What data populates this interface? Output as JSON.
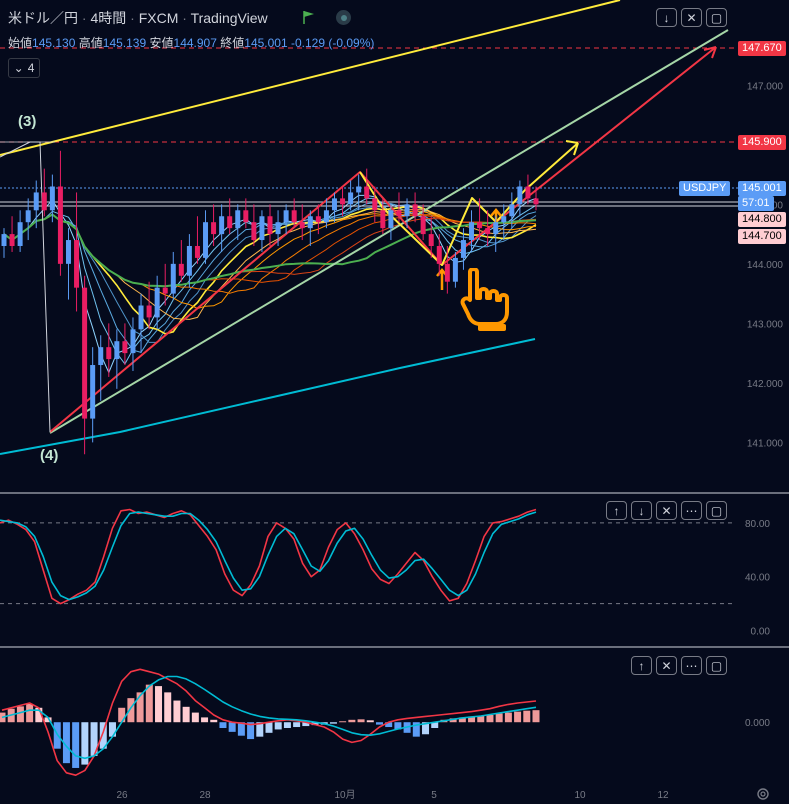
{
  "header": {
    "symbol": "米ドル／円",
    "interval": "4時間",
    "broker": "FXCM",
    "platform": "TradingView",
    "sep": "·"
  },
  "ohlc": {
    "open_label": "始値",
    "open": "145.130",
    "high_label": "高値",
    "high": "145.139",
    "low_label": "安値",
    "low": "144.907",
    "close_label": "終値",
    "close": "145.001",
    "change": "-0.129 (-0.09%)"
  },
  "indicator_toggle": {
    "count": "4"
  },
  "price_labels": {
    "target_high": "147.670",
    "target_mid": "145.900",
    "ticker": "USDJPY",
    "last": "145.001",
    "countdown": "57:01",
    "level_a": "144.800",
    "level_b": "144.700"
  },
  "wave_labels": {
    "top": "(3)",
    "bottom": "(4)"
  },
  "colors": {
    "bg": "#050a1c",
    "up": "#5b9cf6",
    "down": "#e91e63",
    "yellow": "#ffeb3b",
    "red": "#f23645",
    "teal": "#00bcd4",
    "green": "#4caf50",
    "light_green": "#a5d6a7",
    "orange": "#ff9800"
  },
  "icons": [
    "chevron-down-icon",
    "collapse-icon",
    "maximize-icon",
    "arrow-up-icon",
    "arrow-down-icon",
    "close-icon",
    "gear-icon",
    "pointing-hand-icon",
    "up-arrow-marker"
  ],
  "chart_data": [
    {
      "type": "candlestick",
      "title": "米ドル／円 · 4時間 · FXCM",
      "y_axis": {
        "ticks": [
          141.0,
          142.0,
          143.0,
          144.0,
          145.0,
          146.0,
          147.0
        ],
        "tick_labels": [
          "141.000",
          "142.000",
          "143.000",
          "144.000",
          "145.000",
          "146.000",
          "147.000"
        ],
        "range": [
          140.2,
          148.4
        ]
      },
      "x_axis": {
        "tick_labels": [
          "26",
          "28",
          "10月",
          "5",
          "10",
          "12"
        ]
      },
      "candles": [
        {
          "o": 144.3,
          "h": 144.6,
          "l": 144.1,
          "c": 144.5
        },
        {
          "o": 144.5,
          "h": 144.8,
          "l": 144.2,
          "c": 144.3
        },
        {
          "o": 144.3,
          "h": 144.9,
          "l": 144.2,
          "c": 144.7
        },
        {
          "o": 144.7,
          "h": 145.1,
          "l": 144.4,
          "c": 144.9
        },
        {
          "o": 144.9,
          "h": 145.4,
          "l": 144.6,
          "c": 145.2
        },
        {
          "o": 145.2,
          "h": 145.6,
          "l": 144.8,
          "c": 144.9
        },
        {
          "o": 144.9,
          "h": 145.5,
          "l": 144.7,
          "c": 145.3
        },
        {
          "o": 145.3,
          "h": 145.9,
          "l": 143.8,
          "c": 144.0
        },
        {
          "o": 144.0,
          "h": 144.6,
          "l": 143.4,
          "c": 144.4
        },
        {
          "o": 144.4,
          "h": 145.2,
          "l": 143.2,
          "c": 143.6
        },
        {
          "o": 143.6,
          "h": 143.8,
          "l": 140.8,
          "c": 141.4
        },
        {
          "o": 141.4,
          "h": 142.6,
          "l": 141.0,
          "c": 142.3
        },
        {
          "o": 142.3,
          "h": 142.8,
          "l": 141.7,
          "c": 142.6
        },
        {
          "o": 142.6,
          "h": 143.0,
          "l": 142.1,
          "c": 142.4
        },
        {
          "o": 142.4,
          "h": 142.9,
          "l": 141.9,
          "c": 142.7
        },
        {
          "o": 142.7,
          "h": 143.0,
          "l": 142.3,
          "c": 142.5
        },
        {
          "o": 142.5,
          "h": 143.1,
          "l": 142.2,
          "c": 142.9
        },
        {
          "o": 142.9,
          "h": 143.5,
          "l": 142.5,
          "c": 143.3
        },
        {
          "o": 143.3,
          "h": 143.7,
          "l": 142.9,
          "c": 143.1
        },
        {
          "o": 143.1,
          "h": 143.8,
          "l": 142.9,
          "c": 143.6
        },
        {
          "o": 143.6,
          "h": 144.0,
          "l": 143.3,
          "c": 143.5
        },
        {
          "o": 143.5,
          "h": 144.2,
          "l": 143.4,
          "c": 144.0
        },
        {
          "o": 144.0,
          "h": 144.4,
          "l": 143.7,
          "c": 143.8
        },
        {
          "o": 143.8,
          "h": 144.5,
          "l": 143.6,
          "c": 144.3
        },
        {
          "o": 144.3,
          "h": 144.8,
          "l": 144.0,
          "c": 144.1
        },
        {
          "o": 144.1,
          "h": 144.9,
          "l": 144.0,
          "c": 144.7
        },
        {
          "o": 144.7,
          "h": 145.0,
          "l": 144.3,
          "c": 144.5
        },
        {
          "o": 144.5,
          "h": 145.0,
          "l": 144.2,
          "c": 144.8
        },
        {
          "o": 144.8,
          "h": 145.1,
          "l": 144.5,
          "c": 144.6
        },
        {
          "o": 144.6,
          "h": 145.0,
          "l": 144.4,
          "c": 144.9
        },
        {
          "o": 144.9,
          "h": 145.1,
          "l": 144.6,
          "c": 144.7
        },
        {
          "o": 144.7,
          "h": 145.0,
          "l": 144.3,
          "c": 144.4
        },
        {
          "o": 144.4,
          "h": 144.9,
          "l": 144.2,
          "c": 144.8
        },
        {
          "o": 144.8,
          "h": 145.0,
          "l": 144.3,
          "c": 144.5
        },
        {
          "o": 144.5,
          "h": 144.9,
          "l": 144.3,
          "c": 144.7
        },
        {
          "o": 144.7,
          "h": 145.0,
          "l": 144.5,
          "c": 144.9
        },
        {
          "o": 144.9,
          "h": 145.1,
          "l": 144.6,
          "c": 144.7
        },
        {
          "o": 144.7,
          "h": 145.0,
          "l": 144.4,
          "c": 144.6
        },
        {
          "o": 144.6,
          "h": 144.9,
          "l": 144.3,
          "c": 144.8
        },
        {
          "o": 144.8,
          "h": 145.0,
          "l": 144.5,
          "c": 144.7
        },
        {
          "o": 144.7,
          "h": 145.1,
          "l": 144.6,
          "c": 144.9
        },
        {
          "o": 144.9,
          "h": 145.2,
          "l": 144.7,
          "c": 145.1
        },
        {
          "o": 145.1,
          "h": 145.3,
          "l": 144.8,
          "c": 145.0
        },
        {
          "o": 145.0,
          "h": 145.4,
          "l": 144.9,
          "c": 145.2
        },
        {
          "o": 145.2,
          "h": 145.5,
          "l": 144.9,
          "c": 145.3
        },
        {
          "o": 145.3,
          "h": 145.6,
          "l": 145.0,
          "c": 145.1
        },
        {
          "o": 145.1,
          "h": 145.3,
          "l": 144.7,
          "c": 144.9
        },
        {
          "o": 144.9,
          "h": 145.1,
          "l": 144.5,
          "c": 144.6
        },
        {
          "o": 144.6,
          "h": 145.0,
          "l": 144.4,
          "c": 144.9
        },
        {
          "o": 144.9,
          "h": 145.2,
          "l": 144.7,
          "c": 144.8
        },
        {
          "o": 144.8,
          "h": 145.1,
          "l": 144.6,
          "c": 145.0
        },
        {
          "o": 145.0,
          "h": 145.2,
          "l": 144.7,
          "c": 144.8
        },
        {
          "o": 144.8,
          "h": 145.0,
          "l": 144.4,
          "c": 144.5
        },
        {
          "o": 144.5,
          "h": 144.8,
          "l": 144.1,
          "c": 144.3
        },
        {
          "o": 144.3,
          "h": 144.5,
          "l": 143.8,
          "c": 144.0
        },
        {
          "o": 144.0,
          "h": 144.3,
          "l": 143.5,
          "c": 143.7
        },
        {
          "o": 143.7,
          "h": 144.2,
          "l": 143.6,
          "c": 144.1
        },
        {
          "o": 144.1,
          "h": 144.6,
          "l": 143.9,
          "c": 144.4
        },
        {
          "o": 144.4,
          "h": 144.9,
          "l": 144.2,
          "c": 144.7
        },
        {
          "o": 144.7,
          "h": 145.1,
          "l": 144.4,
          "c": 144.6
        },
        {
          "o": 144.6,
          "h": 144.9,
          "l": 144.3,
          "c": 144.5
        },
        {
          "o": 144.5,
          "h": 144.8,
          "l": 144.2,
          "c": 144.7
        },
        {
          "o": 144.7,
          "h": 145.0,
          "l": 144.4,
          "c": 144.8
        },
        {
          "o": 144.8,
          "h": 145.2,
          "l": 144.6,
          "c": 145.0
        },
        {
          "o": 145.0,
          "h": 145.4,
          "l": 144.8,
          "c": 145.3
        },
        {
          "o": 145.3,
          "h": 145.5,
          "l": 145.0,
          "c": 145.1
        },
        {
          "o": 145.1,
          "h": 145.3,
          "l": 144.9,
          "c": 145.0
        }
      ],
      "levels": [
        147.67,
        145.9,
        145.001,
        144.8,
        144.7
      ]
    },
    {
      "type": "line",
      "title": "Stochastic RSI",
      "y_axis": {
        "tick_labels": [
          "80.00",
          "40.00",
          "0.00"
        ],
        "ticks": [
          80,
          40,
          0
        ],
        "range": [
          -10,
          100
        ]
      },
      "guides": [
        80,
        20
      ],
      "series": [
        {
          "values": [
            80,
            82,
            79,
            75,
            66,
            45,
            24,
            20,
            23,
            27,
            30,
            36,
            55,
            76,
            89,
            90,
            87,
            88,
            86,
            84,
            87,
            89,
            86,
            78,
            70,
            60,
            42,
            30,
            26,
            34,
            48,
            70,
            80,
            76,
            68,
            50,
            40,
            45,
            62,
            75,
            80,
            72,
            60,
            46,
            38,
            35,
            42,
            50,
            58,
            52,
            40,
            30,
            22,
            24,
            35,
            52,
            70,
            80,
            81,
            83,
            85,
            88,
            90
          ]
        },
        {
          "values": [
            82,
            81,
            80,
            77,
            70,
            55,
            36,
            26,
            23,
            25,
            28,
            33,
            45,
            62,
            78,
            87,
            88,
            87,
            86,
            85,
            85,
            87,
            87,
            82,
            75,
            66,
            52,
            39,
            30,
            31,
            40,
            56,
            70,
            76,
            72,
            60,
            48,
            44,
            52,
            65,
            74,
            76,
            68,
            56,
            45,
            39,
            40,
            45,
            52,
            53,
            46,
            38,
            30,
            26,
            30,
            42,
            58,
            72,
            79,
            81,
            83,
            86,
            88
          ]
        }
      ]
    },
    {
      "type": "bar",
      "title": "MACD",
      "y_axis": {
        "tick_labels": [
          "0.000"
        ],
        "ticks": [
          0
        ],
        "range": [
          -1.2,
          1.5
        ]
      },
      "histogram": [
        0.2,
        0.28,
        0.33,
        0.38,
        0.3,
        0.1,
        -0.55,
        -0.85,
        -0.95,
        -0.88,
        -0.7,
        -0.55,
        -0.3,
        0.3,
        0.5,
        0.62,
        0.78,
        0.75,
        0.62,
        0.45,
        0.32,
        0.2,
        0.1,
        0.05,
        -0.12,
        -0.2,
        -0.28,
        -0.35,
        -0.3,
        -0.22,
        -0.15,
        -0.12,
        -0.1,
        -0.08,
        -0.06,
        -0.05,
        -0.03,
        0.02,
        0.05,
        0.06,
        0.04,
        -0.05,
        -0.1,
        -0.15,
        -0.22,
        -0.3,
        -0.25,
        -0.12,
        0.05,
        0.08,
        0.1,
        0.12,
        0.13,
        0.15,
        0.18,
        0.2,
        0.22,
        0.24,
        0.25
      ],
      "series": [
        {
          "values": [
            0.25,
            0.3,
            0.35,
            0.4,
            0.3,
            -0.2,
            -0.8,
            -1.05,
            -1.1,
            -1.0,
            -0.7,
            -0.2,
            0.4,
            0.85,
            1.05,
            1.1,
            1.05,
            1.0,
            0.9,
            0.8,
            0.65,
            0.45,
            0.3,
            0.15,
            0.05,
            0.0,
            -0.02,
            -0.05,
            -0.03,
            0.0,
            0.03,
            0.05,
            0.03,
            0.0,
            -0.05,
            -0.1,
            -0.2,
            -0.35,
            -0.42,
            -0.38,
            -0.25,
            -0.1,
            0.0,
            0.05,
            0.08,
            0.1,
            0.12,
            0.14,
            0.16,
            0.18,
            0.2,
            0.22,
            0.25,
            0.28,
            0.33,
            0.37,
            0.4,
            0.42,
            0.44
          ]
        },
        {
          "values": [
            0.1,
            0.15,
            0.2,
            0.25,
            0.25,
            0.1,
            -0.25,
            -0.5,
            -0.7,
            -0.75,
            -0.7,
            -0.55,
            -0.3,
            0.0,
            0.3,
            0.55,
            0.75,
            0.88,
            0.95,
            0.95,
            0.9,
            0.8,
            0.68,
            0.55,
            0.42,
            0.32,
            0.24,
            0.17,
            0.12,
            0.09,
            0.07,
            0.06,
            0.05,
            0.03,
            0.0,
            -0.03,
            -0.08,
            -0.15,
            -0.22,
            -0.26,
            -0.27,
            -0.24,
            -0.19,
            -0.14,
            -0.1,
            -0.06,
            -0.03,
            0.0,
            0.03,
            0.06,
            0.09,
            0.11,
            0.13,
            0.16,
            0.19,
            0.22,
            0.25,
            0.28,
            0.31
          ]
        }
      ]
    }
  ]
}
